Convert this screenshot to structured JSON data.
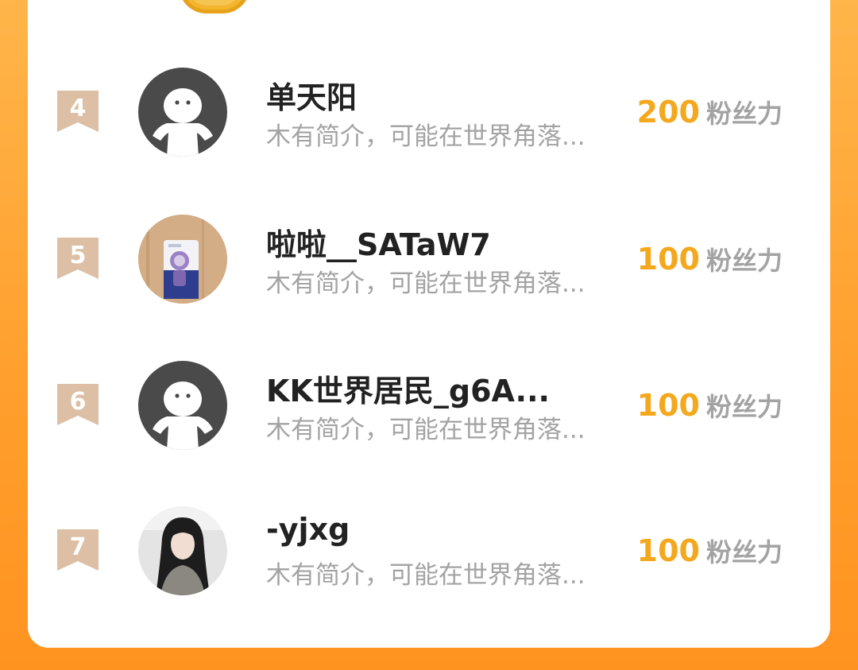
{
  "colors": {
    "background_orange": "#ff9e2c",
    "card": "#ffffff",
    "rank_badge": "#dcbfa5",
    "score": "#f4a81e",
    "name": "#222222",
    "muted": "#a3a3a3"
  },
  "ranking": {
    "items": [
      {
        "rank": "4",
        "name": "单天阳",
        "bio": "木有简介，可能在世界角落...",
        "score": "200",
        "unit": "粉丝力",
        "avatar": "default-avatar-icon"
      },
      {
        "rank": "5",
        "name": "啦啦__SATaW7",
        "bio": "木有简介，可能在世界角落...",
        "score": "100",
        "unit": "粉丝力",
        "avatar": "photo-avatar"
      },
      {
        "rank": "6",
        "name": "KK世界居民_g6A...",
        "bio": "木有简介，可能在世界角落...",
        "score": "100",
        "unit": "粉丝力",
        "avatar": "default-avatar-icon"
      },
      {
        "rank": "7",
        "name": "-yjxg",
        "bio": "木有简介，可能在世界角落...",
        "score": "100",
        "unit": "粉丝力",
        "avatar": "photo-avatar"
      }
    ]
  }
}
